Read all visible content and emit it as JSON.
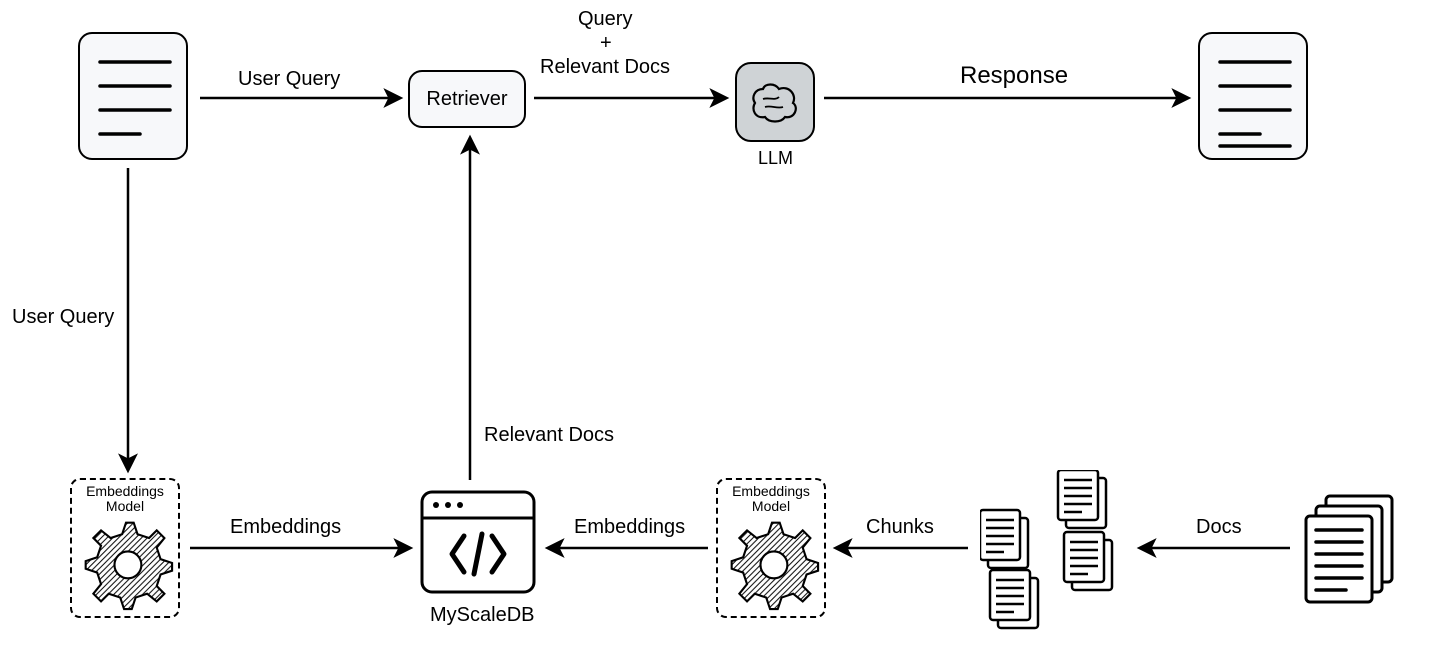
{
  "diagram": {
    "nodes": {
      "query_doc": "query-document",
      "retriever": "Retriever",
      "llm": "LLM",
      "response_doc": "response-document",
      "embeddings_left_title": "Embeddings\nModel",
      "embeddings_right_title": "Embeddings\nModel",
      "myscaledb": "MyScaleDB",
      "chunks": "chunks-documents",
      "docs": "docs-documents"
    },
    "edges": {
      "user_query_top": "User Query",
      "query_plus_docs_l1": "Query",
      "query_plus_docs_plus": "+",
      "query_plus_docs_l2": "Relevant Docs",
      "response": "Response",
      "user_query_left": "User Query",
      "relevant_docs": "Relevant Docs",
      "embeddings_left": "Embeddings",
      "embeddings_right": "Embeddings",
      "chunks": "Chunks",
      "docs": "Docs"
    }
  }
}
